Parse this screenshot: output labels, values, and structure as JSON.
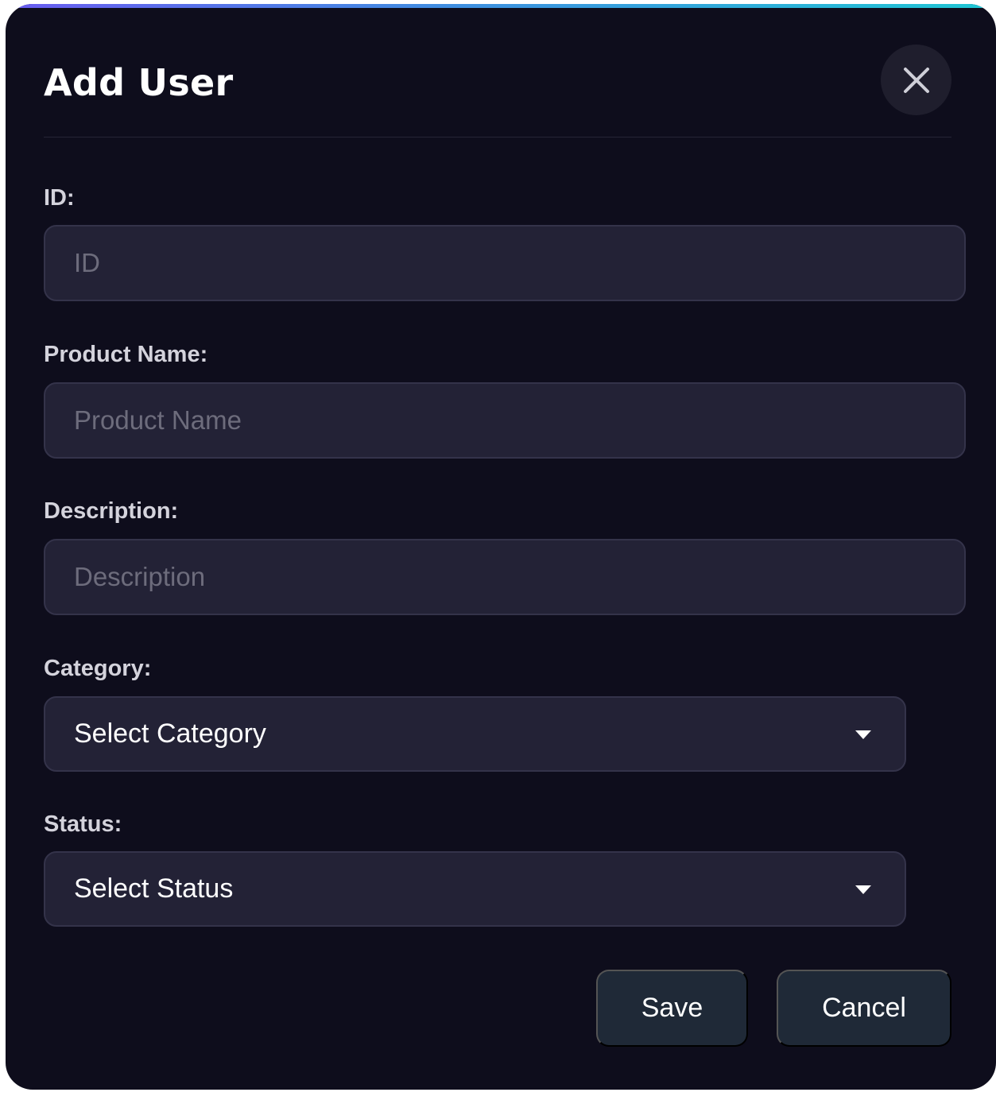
{
  "modal": {
    "title": "Add User",
    "close_icon": "close-icon",
    "accent_gradient": [
      "#6a5cf0",
      "#3f8ee0",
      "#1fc7d4"
    ],
    "background": "#0e0d1c"
  },
  "form": {
    "id": {
      "label": "ID:",
      "placeholder": "ID",
      "value": ""
    },
    "product_name": {
      "label": "Product Name:",
      "placeholder": "Product Name",
      "value": ""
    },
    "description": {
      "label": "Description:",
      "placeholder": "Description",
      "value": ""
    },
    "category": {
      "label": "Category:",
      "selected": "Select Category",
      "icon": "caret-down-icon"
    },
    "status": {
      "label": "Status:",
      "selected": "Select Status",
      "icon": "caret-down-icon"
    }
  },
  "actions": {
    "save_label": "Save",
    "cancel_label": "Cancel",
    "button_color": "#1f2937"
  }
}
